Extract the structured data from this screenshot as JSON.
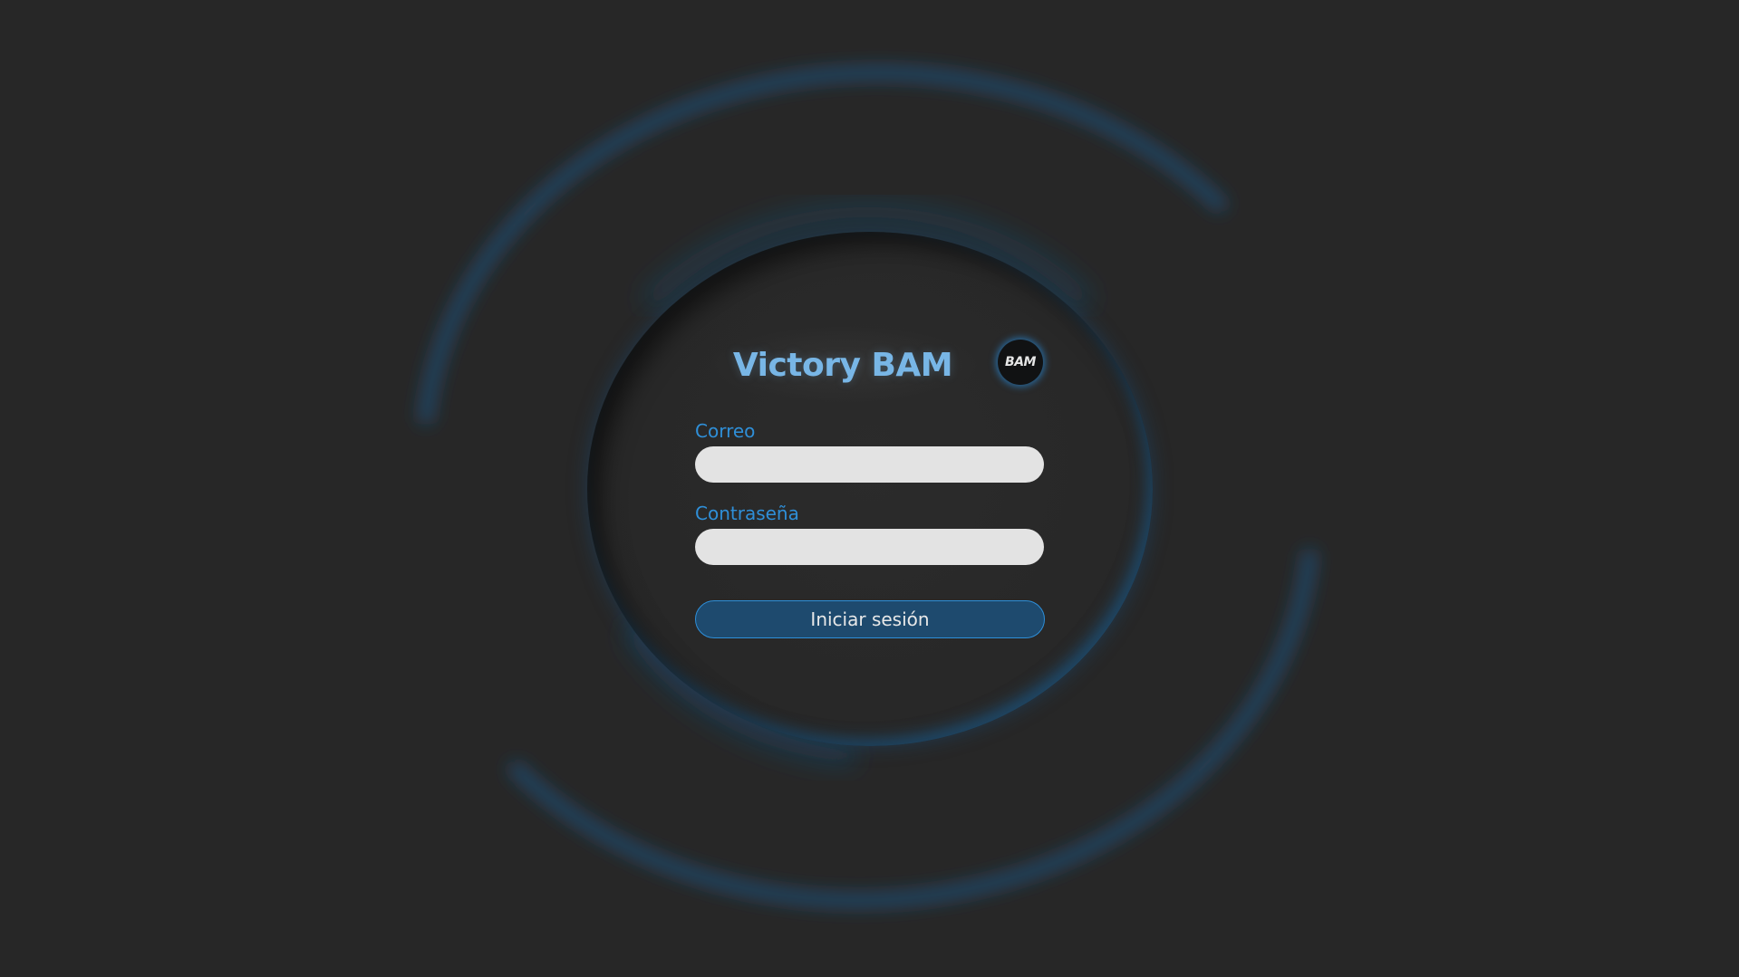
{
  "app": {
    "title": "Victory BAM",
    "logo_text": "BAM"
  },
  "login_form": {
    "email_label": "Correo",
    "email_value": "",
    "password_label": "Contraseña",
    "password_value": "",
    "submit_label": "Iniciar sesión"
  },
  "colors": {
    "background": "#272727",
    "accent": "#2f8fd8",
    "title": "#78b6e6",
    "button_fill": "#1e4a6e",
    "input_fill": "#e3e3e3"
  },
  "icons": {
    "logo": "bam-logo-icon"
  }
}
